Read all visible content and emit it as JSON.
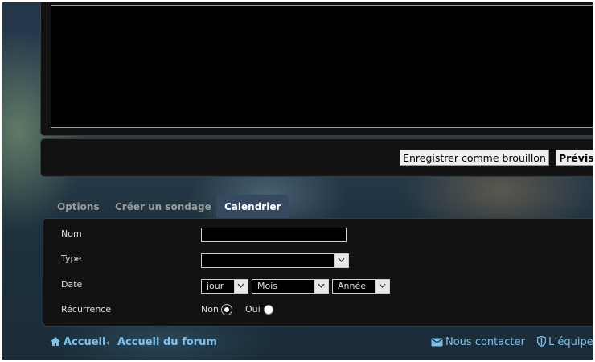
{
  "editor": {
    "buttons": {
      "save_draft": "Enregistrer comme brouillon",
      "preview": "Prévis"
    }
  },
  "tabs": [
    {
      "label": "Options",
      "active": false
    },
    {
      "label": "Créer un sondage",
      "active": false
    },
    {
      "label": "Calendrier",
      "active": true
    }
  ],
  "calendar_form": {
    "name_label": "Nom",
    "name_value": "",
    "type_label": "Type",
    "type_value": "",
    "date_label": "Date",
    "day_value": "jour",
    "month_value": "Mois",
    "year_value": "Année",
    "recurrence_label": "Récurrence",
    "recurrence_options": [
      {
        "label": "Non",
        "selected": true
      },
      {
        "label": "Oui",
        "selected": false
      }
    ]
  },
  "footer": {
    "home": "Accueil",
    "separator": "‹",
    "forum_home": "Accueil du forum",
    "contact": "Nous contacter",
    "team": "L’équipe"
  },
  "icons": {
    "home": "home-icon",
    "contact": "envelope-icon",
    "team": "shield-icon",
    "dropdown": "chevron-down-icon"
  },
  "colors": {
    "panel": "#121212",
    "active_tab": "#36495e",
    "link": "#7dc0ec"
  }
}
